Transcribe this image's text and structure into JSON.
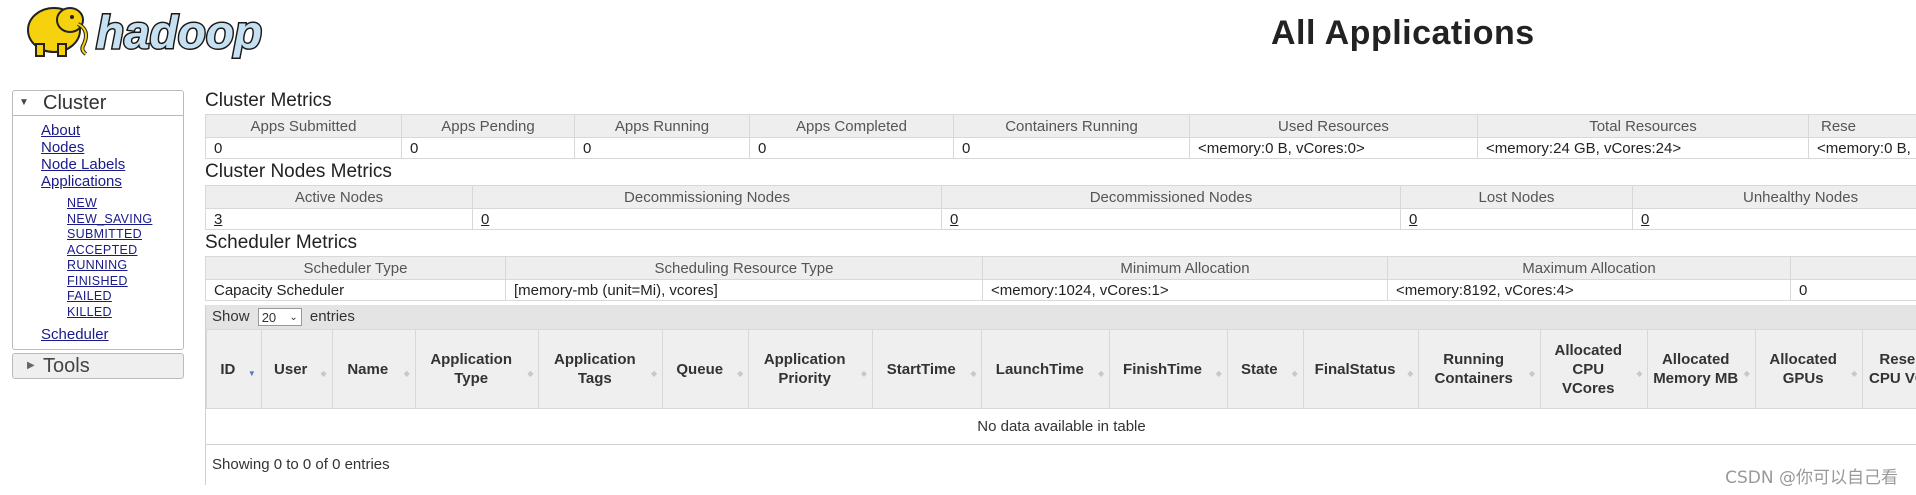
{
  "header": {
    "logo_text": "hadoop",
    "title": "All Applications"
  },
  "sidebar": {
    "cluster_label": "Cluster",
    "cluster_links": [
      "About",
      "Nodes",
      "Node Labels",
      "Applications"
    ],
    "app_states": [
      "NEW",
      "NEW_SAVING",
      "SUBMITTED",
      "ACCEPTED",
      "RUNNING",
      "FINISHED",
      "FAILED",
      "KILLED"
    ],
    "scheduler_link": "Scheduler",
    "tools_label": "Tools"
  },
  "cluster_metrics": {
    "title": "Cluster Metrics",
    "headers": [
      "Apps Submitted",
      "Apps Pending",
      "Apps Running",
      "Apps Completed",
      "Containers Running",
      "Used Resources",
      "Total Resources",
      "Rese"
    ],
    "values": [
      "0",
      "0",
      "0",
      "0",
      "0",
      "<memory:0 B, vCores:0>",
      "<memory:24 GB, vCores:24>",
      "<memory:0 B,"
    ]
  },
  "cluster_nodes_metrics": {
    "title": "Cluster Nodes Metrics",
    "headers": [
      "Active Nodes",
      "Decommissioning Nodes",
      "Decommissioned Nodes",
      "Lost Nodes",
      "Unhealthy Nodes"
    ],
    "values": [
      "3",
      "0",
      "0",
      "0",
      "0"
    ]
  },
  "scheduler_metrics": {
    "title": "Scheduler Metrics",
    "headers": [
      "Scheduler Type",
      "Scheduling Resource Type",
      "Minimum Allocation",
      "Maximum Allocation",
      ""
    ],
    "values": [
      "Capacity Scheduler",
      "[memory-mb (unit=Mi), vcores]",
      "<memory:1024, vCores:1>",
      "<memory:8192, vCores:4>",
      "0"
    ]
  },
  "apps_table": {
    "show_label": "Show",
    "page_size": "20",
    "entries_label": "entries",
    "columns": [
      "ID",
      "User",
      "Name",
      "Application Type",
      "Application Tags",
      "Queue",
      "Application Priority",
      "StartTime",
      "LaunchTime",
      "FinishTime",
      "State",
      "FinalStatus",
      "Running Containers",
      "Allocated CPU VCores",
      "Allocated Memory MB",
      "Allocated GPUs",
      "Reserved CPU VCores"
    ],
    "empty_message": "No data available in table",
    "info": "Showing 0 to 0 of 0 entries"
  },
  "watermark": "CSDN @你可以自己看"
}
